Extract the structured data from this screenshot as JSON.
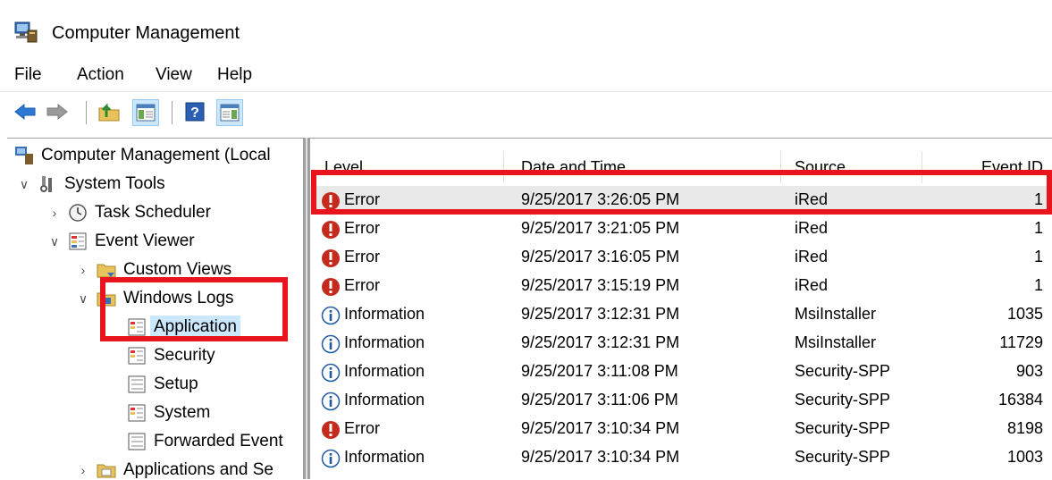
{
  "window": {
    "title": "Computer Management"
  },
  "menu": [
    "File",
    "Action",
    "View",
    "Help"
  ],
  "tree": {
    "root": "Computer Management (Local",
    "system_tools": "System Tools",
    "task_scheduler": "Task Scheduler",
    "event_viewer": "Event Viewer",
    "custom_views": "Custom Views",
    "windows_logs": "Windows Logs",
    "application": "Application",
    "security": "Security",
    "setup": "Setup",
    "system": "System",
    "forwarded": "Forwarded Event",
    "apps_services": "Applications and Se"
  },
  "list": {
    "headers": {
      "level": "Level",
      "datetime": "Date and Time",
      "source": "Source",
      "event_id": "Event ID"
    },
    "rows": [
      {
        "level": "Error",
        "datetime": "9/25/2017 3:26:05 PM",
        "source": "iRed",
        "event_id": "1"
      },
      {
        "level": "Error",
        "datetime": "9/25/2017 3:21:05 PM",
        "source": "iRed",
        "event_id": "1"
      },
      {
        "level": "Error",
        "datetime": "9/25/2017 3:16:05 PM",
        "source": "iRed",
        "event_id": "1"
      },
      {
        "level": "Error",
        "datetime": "9/25/2017 3:15:19 PM",
        "source": "iRed",
        "event_id": "1"
      },
      {
        "level": "Information",
        "datetime": "9/25/2017 3:12:31 PM",
        "source": "MsiInstaller",
        "event_id": "1035"
      },
      {
        "level": "Information",
        "datetime": "9/25/2017 3:12:31 PM",
        "source": "MsiInstaller",
        "event_id": "11729"
      },
      {
        "level": "Information",
        "datetime": "9/25/2017 3:11:08 PM",
        "source": "Security-SPP",
        "event_id": "903"
      },
      {
        "level": "Information",
        "datetime": "9/25/2017 3:11:06 PM",
        "source": "Security-SPP",
        "event_id": "16384"
      },
      {
        "level": "Error",
        "datetime": "9/25/2017 3:10:34 PM",
        "source": "Security-SPP",
        "event_id": "8198"
      },
      {
        "level": "Information",
        "datetime": "9/25/2017 3:10:34 PM",
        "source": "Security-SPP",
        "event_id": "1003"
      }
    ]
  },
  "icons": {
    "error": "error-icon",
    "information": "information-icon"
  },
  "colors": {
    "highlight": "#e8141e",
    "error": "#c42b1c",
    "info": "#1e5aa8",
    "selection": "#cce8ff"
  }
}
